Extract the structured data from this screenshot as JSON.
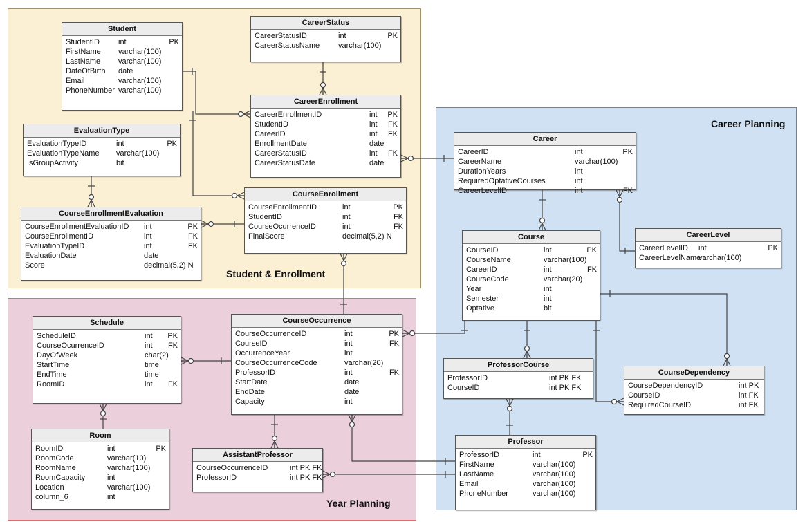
{
  "colors": {
    "student_region_fill": "#fcf0d4",
    "student_region_border": "#a0926c",
    "year_region_fill": "#ebcfdb",
    "year_region_border": "#e06c6c",
    "career_region_fill": "#cfe1f3",
    "career_region_border": "#7a7f86",
    "line": "#444444"
  },
  "regions": [
    {
      "id": "student-enrollment",
      "label": "Student & Enrollment"
    },
    {
      "id": "year-planning",
      "label": "Year Planning"
    },
    {
      "id": "career-planning",
      "label": "Career Planning"
    }
  ],
  "tables": [
    {
      "id": "Student",
      "title": "Student",
      "columns": [
        [
          "StudentID",
          "int",
          "PK"
        ],
        [
          "FirstName",
          "varchar(100)",
          ""
        ],
        [
          "LastName",
          "varchar(100)",
          ""
        ],
        [
          "DateOfBirth",
          "date",
          ""
        ],
        [
          "Email",
          "varchar(100)",
          ""
        ],
        [
          "PhoneNumber",
          "varchar(100)",
          ""
        ]
      ]
    },
    {
      "id": "CareerStatus",
      "title": "CareerStatus",
      "columns": [
        [
          "CareerStatusID",
          "int",
          "PK"
        ],
        [
          "CareerStatusName",
          "varchar(100)",
          ""
        ]
      ]
    },
    {
      "id": "CareerEnrollment",
      "title": "CareerEnrollment",
      "columns": [
        [
          "CareerEnrollmentID",
          "int",
          "PK"
        ],
        [
          "StudentID",
          "int",
          "FK"
        ],
        [
          "CareerID",
          "int",
          "FK"
        ],
        [
          "EnrollmentDate",
          "date",
          ""
        ],
        [
          "CareerStatusID",
          "int",
          "FK"
        ],
        [
          "CareerStatusDate",
          "date",
          ""
        ]
      ]
    },
    {
      "id": "EvaluationType",
      "title": "EvaluationType",
      "columns": [
        [
          "EvaluationTypeID",
          "int",
          "PK"
        ],
        [
          "EvaluationTypeName",
          "varchar(100)",
          ""
        ],
        [
          "IsGroupActivity",
          "bit",
          ""
        ]
      ]
    },
    {
      "id": "CourseEnrollmentEvaluation",
      "title": "CourseEnrollmentEvaluation",
      "columns": [
        [
          "CourseEnrollmentEvaluationID",
          "int",
          "PK"
        ],
        [
          "CourseEnrollmentID",
          "int",
          "FK"
        ],
        [
          "EvaluationTypeID",
          "int",
          "FK"
        ],
        [
          "EvaluationDate",
          "date",
          ""
        ],
        [
          "Score",
          "decimal(5,2) N",
          ""
        ]
      ]
    },
    {
      "id": "CourseEnrollment",
      "title": "CourseEnrollment",
      "columns": [
        [
          "CourseEnrollmentID",
          "int",
          "PK"
        ],
        [
          "StudentID",
          "int",
          "FK"
        ],
        [
          "CourseOcurrenceID",
          "int",
          "FK"
        ],
        [
          "FinalScore",
          "decimal(5,2) N",
          ""
        ]
      ]
    },
    {
      "id": "Schedule",
      "title": "Schedule",
      "columns": [
        [
          "ScheduleID",
          "int",
          "PK"
        ],
        [
          "CourseOcurrenceID",
          "int",
          "FK"
        ],
        [
          "DayOfWeek",
          "char(2)",
          ""
        ],
        [
          "StartTime",
          "time",
          ""
        ],
        [
          "EndTime",
          "time",
          ""
        ],
        [
          "RoomID",
          "int",
          "FK"
        ]
      ]
    },
    {
      "id": "Room",
      "title": "Room",
      "columns": [
        [
          "RoomID",
          "int",
          "PK"
        ],
        [
          "RoomCode",
          "varchar(10)",
          ""
        ],
        [
          "RoomName",
          "varchar(100)",
          ""
        ],
        [
          "RoomCapacity",
          "int",
          ""
        ],
        [
          "Location",
          "varchar(100)",
          ""
        ],
        [
          "column_6",
          "int",
          ""
        ]
      ]
    },
    {
      "id": "CourseOccurrence",
      "title": "CourseOccurrence",
      "columns": [
        [
          "CourseOccurrenceID",
          "int",
          "PK"
        ],
        [
          "CourseID",
          "int",
          "FK"
        ],
        [
          "OccurrenceYear",
          "int",
          ""
        ],
        [
          "CourseOccurrenceCode",
          "varchar(20)",
          ""
        ],
        [
          "ProfessorID",
          "int",
          "FK"
        ],
        [
          "StartDate",
          "date",
          ""
        ],
        [
          "EndDate",
          "date",
          ""
        ],
        [
          "Capacity",
          "int",
          ""
        ]
      ]
    },
    {
      "id": "AssistantProfessor",
      "title": "AssistantProfessor",
      "columns": [
        [
          "CourseOccurrenceID",
          "int PK FK",
          ""
        ],
        [
          "ProfessorID",
          "int PK FK",
          ""
        ]
      ]
    },
    {
      "id": "Career",
      "title": "Career",
      "columns": [
        [
          "CareerID",
          "int",
          "PK"
        ],
        [
          "CareerName",
          "varchar(100)",
          ""
        ],
        [
          "DurationYears",
          "int",
          ""
        ],
        [
          "RequiredOptativeCourses",
          "int",
          ""
        ],
        [
          "CareerLevelID",
          "int",
          "FK"
        ]
      ]
    },
    {
      "id": "CareerLevel",
      "title": "CareerLevel",
      "columns": [
        [
          "CareerLevelID",
          "int",
          "PK"
        ],
        [
          "CareerLevelName",
          "varchar(100)",
          ""
        ]
      ]
    },
    {
      "id": "Course",
      "title": "Course",
      "columns": [
        [
          "CourseID",
          "int",
          "PK"
        ],
        [
          "CourseName",
          "varchar(100)",
          ""
        ],
        [
          "CareerID",
          "int",
          "FK"
        ],
        [
          "CourseCode",
          "varchar(20)",
          ""
        ],
        [
          "Year",
          "int",
          ""
        ],
        [
          "Semester",
          "int",
          ""
        ],
        [
          "Optative",
          "bit",
          ""
        ]
      ]
    },
    {
      "id": "ProfessorCourse",
      "title": "ProfessorCourse",
      "columns": [
        [
          "ProfessorID",
          "int PK FK",
          ""
        ],
        [
          "CourseID",
          "int PK FK",
          ""
        ]
      ]
    },
    {
      "id": "CourseDependency",
      "title": "CourseDependency",
      "columns": [
        [
          "CourseDependencyID",
          "int PK",
          ""
        ],
        [
          "CourseID",
          "int FK",
          ""
        ],
        [
          "RequiredCourseID",
          "int FK",
          ""
        ]
      ]
    },
    {
      "id": "Professor",
      "title": "Professor",
      "columns": [
        [
          "ProfessorID",
          "int",
          "PK"
        ],
        [
          "FirstName",
          "varchar(100)",
          ""
        ],
        [
          "LastName",
          "varchar(100)",
          ""
        ],
        [
          "Email",
          "varchar(100)",
          ""
        ],
        [
          "PhoneNumber",
          "varchar(100)",
          ""
        ]
      ]
    }
  ],
  "relationships": [
    {
      "from": "Student",
      "to": "CareerEnrollment",
      "cardinality": "one-to-zero-or-many"
    },
    {
      "from": "CareerStatus",
      "to": "CareerEnrollment",
      "cardinality": "one-to-zero-or-many"
    },
    {
      "from": "Student",
      "to": "CourseEnrollment",
      "cardinality": "one-to-zero-or-many"
    },
    {
      "from": "EvaluationType",
      "to": "CourseEnrollmentEvaluation",
      "cardinality": "one-to-zero-or-many"
    },
    {
      "from": "CourseEnrollment",
      "to": "CourseEnrollmentEvaluation",
      "cardinality": "one-to-zero-or-many"
    },
    {
      "from": "Career",
      "to": "CareerEnrollment",
      "cardinality": "one-to-zero-or-many"
    },
    {
      "from": "CourseOccurrence",
      "to": "CourseEnrollment",
      "cardinality": "one-to-zero-or-many"
    },
    {
      "from": "Career",
      "to": "Course",
      "cardinality": "one-to-zero-or-many"
    },
    {
      "from": "CareerLevel",
      "to": "Career",
      "cardinality": "one-to-zero-or-many"
    },
    {
      "from": "Course",
      "to": "CourseOccurrence",
      "cardinality": "one-to-zero-or-many"
    },
    {
      "from": "Course",
      "to": "CourseDependency",
      "cardinality": "one-to-zero-or-many"
    },
    {
      "from": "Course",
      "to": "ProfessorCourse",
      "cardinality": "one-to-zero-or-many"
    },
    {
      "from": "Course",
      "to": "CourseDependency",
      "cardinality": "one-to-zero-or-many"
    },
    {
      "from": "Professor",
      "to": "ProfessorCourse",
      "cardinality": "one-to-zero-or-many"
    },
    {
      "from": "CourseOccurrence",
      "to": "Schedule",
      "cardinality": "one-to-zero-or-many"
    },
    {
      "from": "Room",
      "to": "Schedule",
      "cardinality": "one-to-zero-or-many"
    },
    {
      "from": "CourseOccurrence",
      "to": "AssistantProfessor",
      "cardinality": "one-to-zero-or-many"
    },
    {
      "from": "Professor",
      "to": "CourseOccurrence",
      "cardinality": "one-to-zero-or-many"
    },
    {
      "from": "Professor",
      "to": "AssistantProfessor",
      "cardinality": "one-to-zero-or-many"
    }
  ]
}
